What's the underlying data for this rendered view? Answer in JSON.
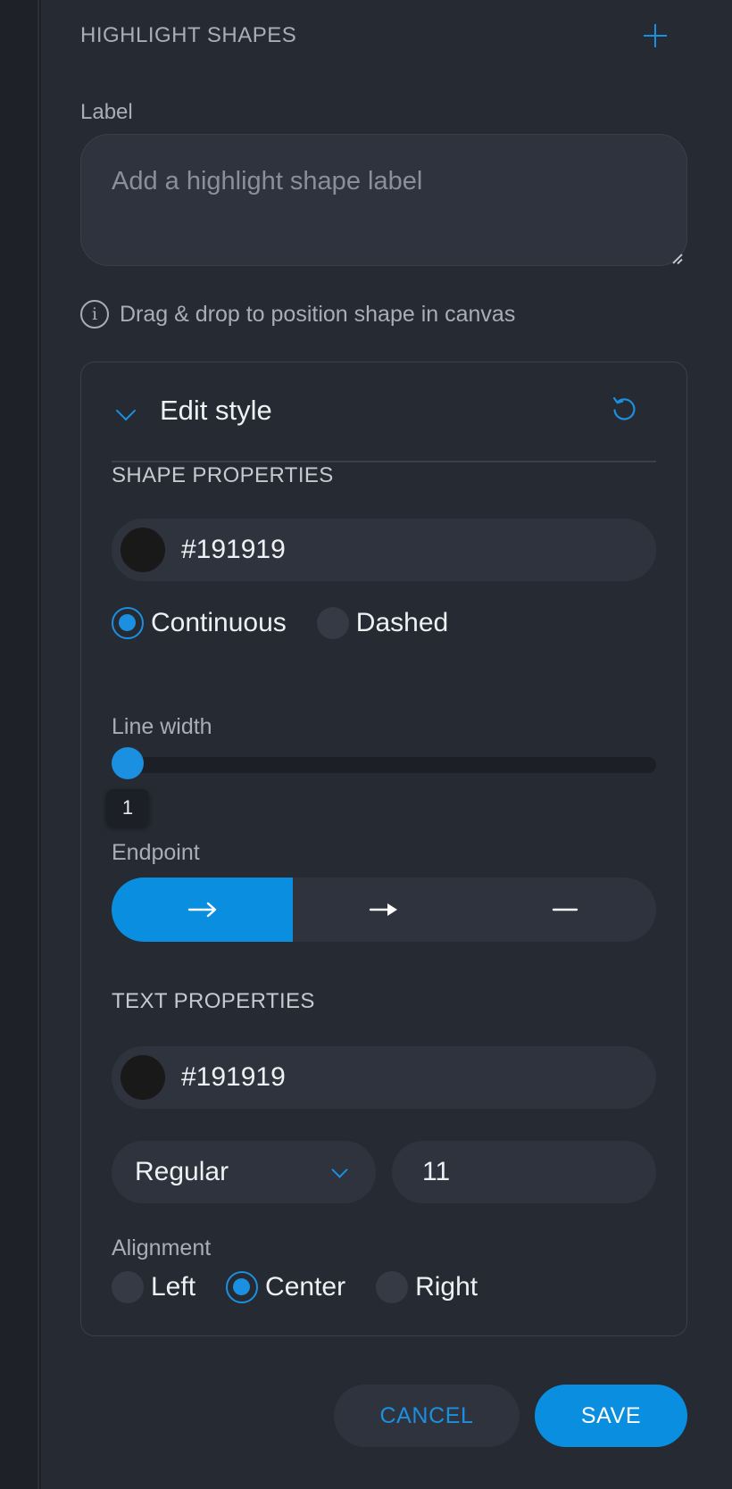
{
  "header": {
    "title": "HIGHLIGHT SHAPES",
    "add_icon": "plus-icon"
  },
  "label_field": {
    "label": "Label",
    "value": "",
    "placeholder": "Add a highlight shape label"
  },
  "hint": {
    "icon": "info-icon",
    "text": "Drag & drop to position shape in canvas"
  },
  "edit_style": {
    "title": "Edit style",
    "expanded": true,
    "reset_icon": "reset-icon",
    "shape_properties": {
      "title": "SHAPE PROPERTIES",
      "color": "#191919",
      "line_styles": [
        {
          "label": "Continuous",
          "selected": true
        },
        {
          "label": "Dashed",
          "selected": false
        }
      ],
      "line_width_label": "Line width",
      "line_width": 1,
      "line_width_min": 1,
      "line_width_max": 10,
      "endpoint_label": "Endpoint",
      "endpoints": [
        {
          "icon": "arrow-open-icon",
          "selected": true
        },
        {
          "icon": "arrow-filled-icon",
          "selected": false
        },
        {
          "icon": "line-none-icon",
          "selected": false
        }
      ]
    },
    "text_properties": {
      "title": "TEXT PROPERTIES",
      "color": "#191919",
      "font_weight": "Regular",
      "font_size": "11",
      "alignment_label": "Alignment",
      "alignments": [
        {
          "label": "Left",
          "selected": false
        },
        {
          "label": "Center",
          "selected": true
        },
        {
          "label": "Right",
          "selected": false
        }
      ]
    }
  },
  "actions": {
    "cancel": "CANCEL",
    "save": "SAVE"
  },
  "colors": {
    "accent": "#1b8fe0",
    "background": "#262a33",
    "field": "#2f333d"
  }
}
